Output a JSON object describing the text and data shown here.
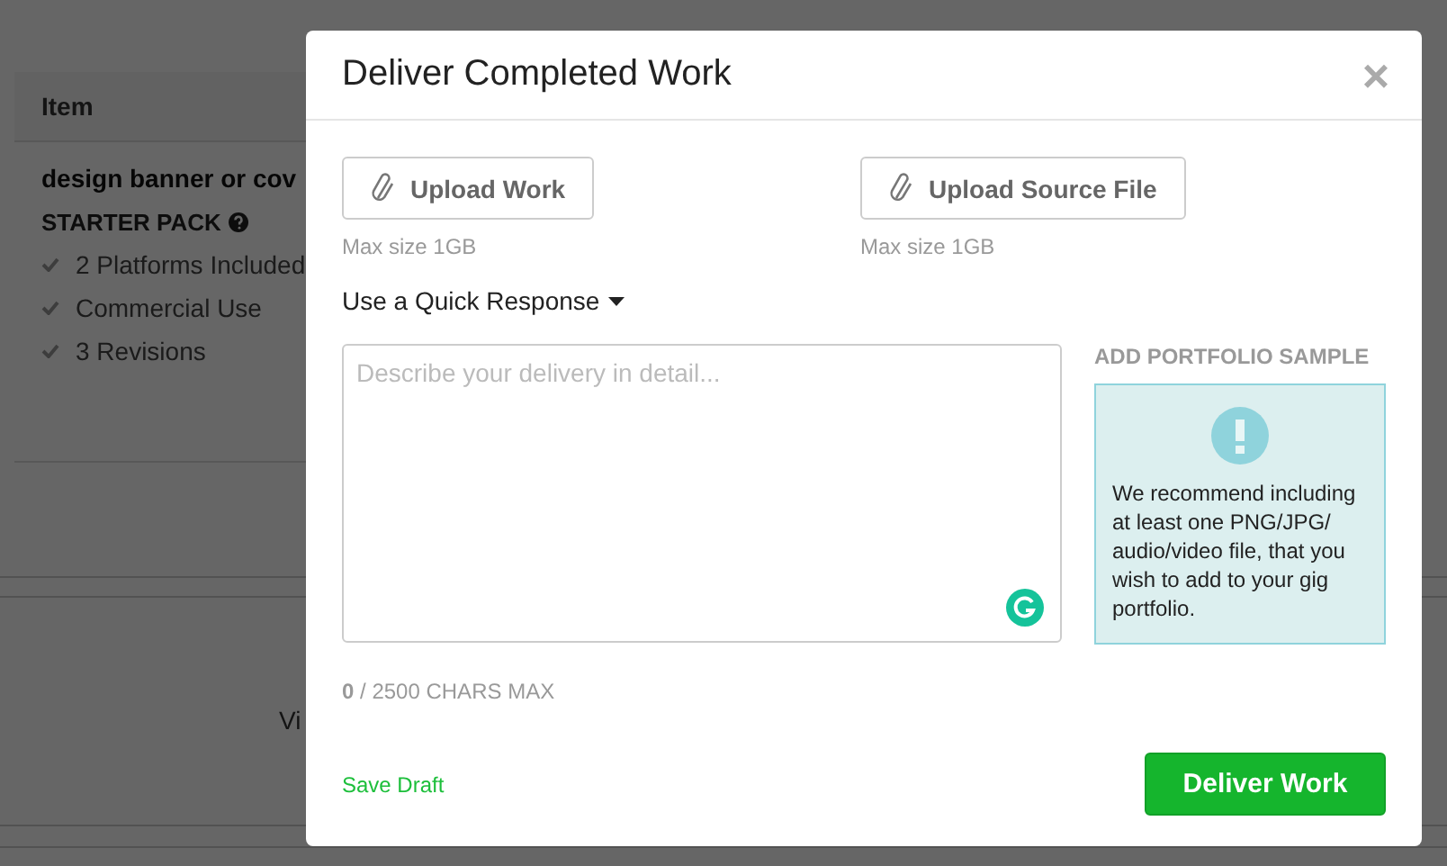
{
  "background_page": {
    "table_header": "Item",
    "item_title": "design banner or cov",
    "package": "STARTER PACK",
    "features": [
      {
        "label": "2 Platforms Included"
      },
      {
        "label": "Commercial Use"
      },
      {
        "label": "3 Revisions"
      }
    ],
    "link_fragment": "Vi"
  },
  "dialog": {
    "title": "Deliver Completed Work",
    "close": "×",
    "uploads": [
      {
        "label": "Upload Work",
        "note": "Max size 1GB"
      },
      {
        "label": "Upload Source File",
        "note": "Max size 1GB"
      }
    ],
    "quick_response": "Use a Quick Response",
    "message": {
      "placeholder": "Describe your delivery in detail..."
    },
    "char_count": {
      "count": "0",
      "limit": "/ 2500 CHARS MAX"
    },
    "portfolio": {
      "heading": "ADD PORTFOLIO SAMPLE",
      "text": "We recommend including at least one PNG/JPG/ audio/video file, that you wish to add to your gig portfolio."
    },
    "save_draft": "Save Draft",
    "deliver": "Deliver Work"
  }
}
